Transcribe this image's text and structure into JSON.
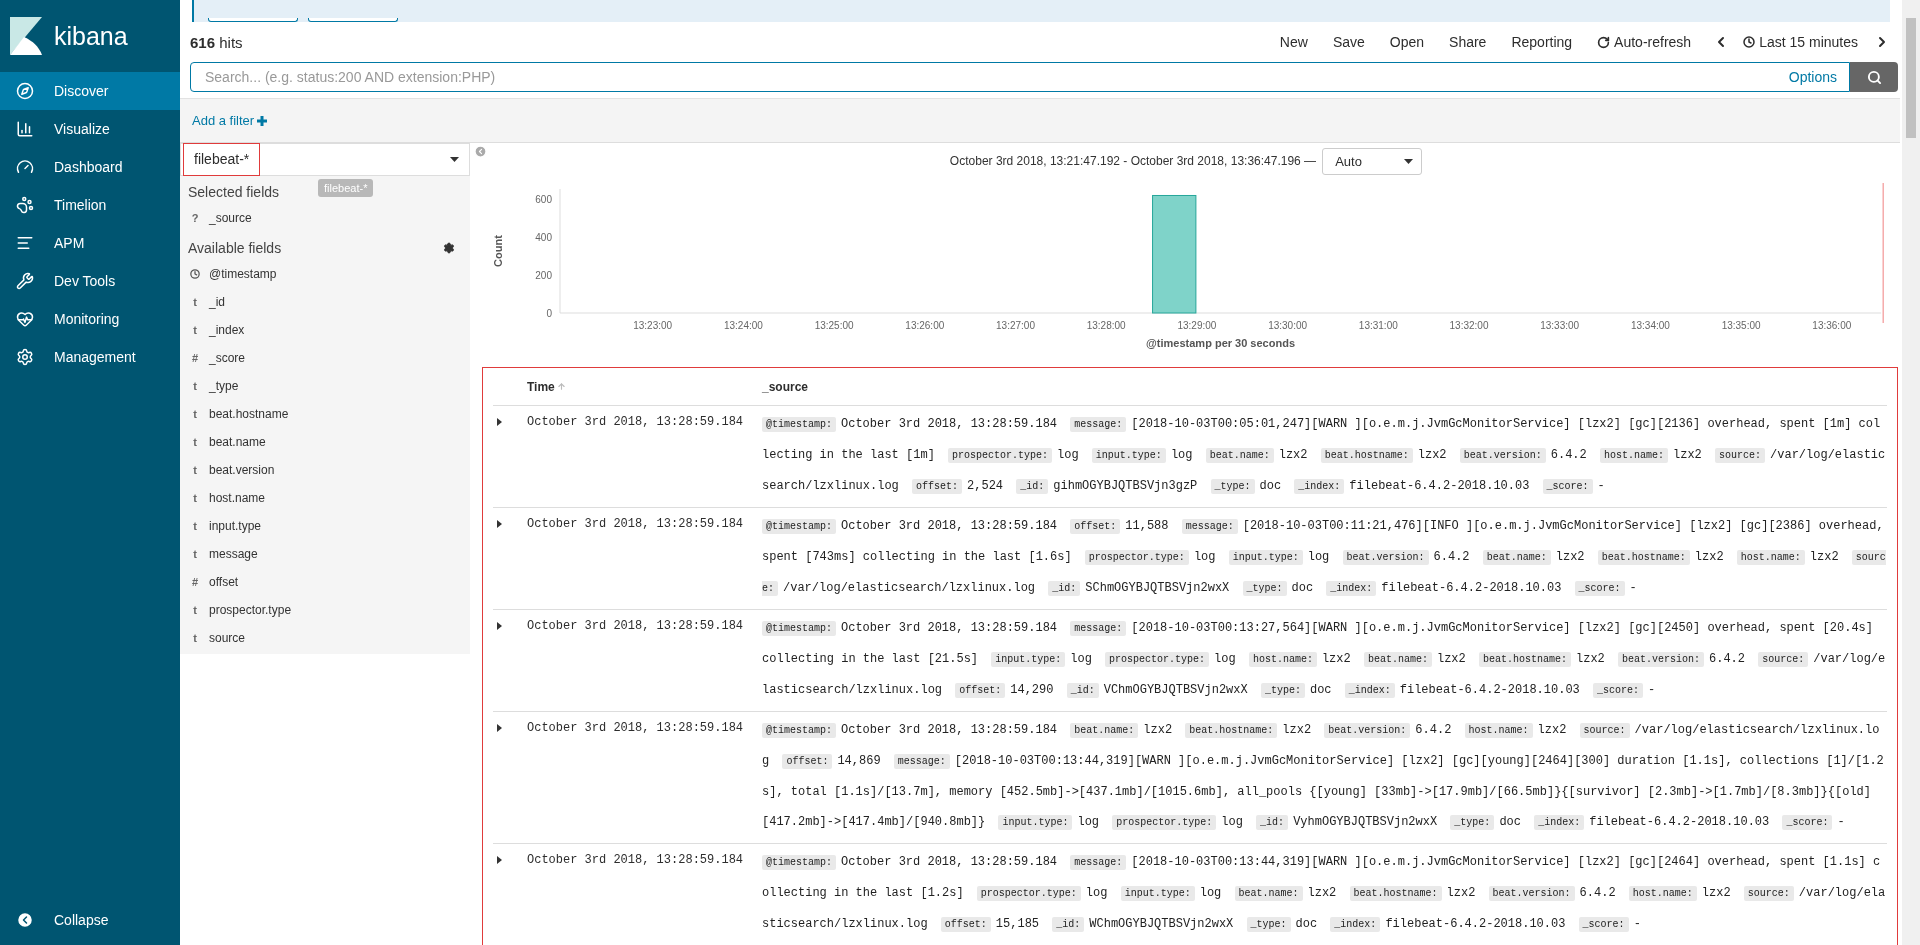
{
  "sidebar": {
    "logo": "kibana",
    "items": [
      {
        "label": "Discover",
        "selected": true
      },
      {
        "label": "Visualize",
        "selected": false
      },
      {
        "label": "Dashboard",
        "selected": false
      },
      {
        "label": "Timelion",
        "selected": false
      },
      {
        "label": "APM",
        "selected": false
      },
      {
        "label": "Dev Tools",
        "selected": false
      },
      {
        "label": "Monitoring",
        "selected": false
      },
      {
        "label": "Management",
        "selected": false
      }
    ],
    "collapse": "Collapse"
  },
  "hits": {
    "count": "616",
    "label": "hits"
  },
  "top_menu": [
    {
      "label": "New",
      "kind": "plain"
    },
    {
      "label": "Save",
      "kind": "plain"
    },
    {
      "label": "Open",
      "kind": "plain"
    },
    {
      "label": "Share",
      "kind": "plain"
    },
    {
      "label": "Reporting",
      "kind": "plain"
    },
    {
      "label": "Auto-refresh",
      "kind": "refresh"
    },
    {
      "label": "Last 15 minutes",
      "kind": "time"
    }
  ],
  "search": {
    "placeholder": "Search... (e.g. status:200 AND extension:PHP)",
    "options": "Options"
  },
  "filter": {
    "add": "Add a filter"
  },
  "index_pattern": {
    "value": "filebeat-*",
    "tooltip": "filebeat-*"
  },
  "selected_fields": {
    "title": "Selected fields",
    "items": [
      {
        "kind": "char",
        "icon": "?",
        "name": "_source"
      }
    ]
  },
  "available_fields": {
    "title": "Available fields",
    "items": [
      {
        "kind": "date",
        "name": "@timestamp"
      },
      {
        "kind": "char",
        "icon": "t",
        "name": "_id"
      },
      {
        "kind": "char",
        "icon": "t",
        "name": "_index"
      },
      {
        "kind": "char",
        "icon": "#",
        "name": "_score"
      },
      {
        "kind": "char",
        "icon": "t",
        "name": "_type"
      },
      {
        "kind": "char",
        "icon": "t",
        "name": "beat.hostname"
      },
      {
        "kind": "char",
        "icon": "t",
        "name": "beat.name"
      },
      {
        "kind": "char",
        "icon": "t",
        "name": "beat.version"
      },
      {
        "kind": "char",
        "icon": "t",
        "name": "host.name"
      },
      {
        "kind": "char",
        "icon": "t",
        "name": "input.type"
      },
      {
        "kind": "char",
        "icon": "t",
        "name": "message"
      },
      {
        "kind": "char",
        "icon": "#",
        "name": "offset"
      },
      {
        "kind": "char",
        "icon": "t",
        "name": "prospector.type"
      },
      {
        "kind": "char",
        "icon": "t",
        "name": "source"
      }
    ]
  },
  "chart": {
    "range": "October 3rd 2018, 13:21:47.192 - October 3rd 2018, 13:36:47.196 —",
    "interval": "Auto",
    "chart_data": {
      "type": "bar",
      "xlabel": "@timestamp per 30 seconds",
      "ylabel": "Count",
      "categories": [
        null,
        null,
        "13:23:00",
        null,
        "13:24:00",
        null,
        "13:25:00",
        null,
        "13:26:00",
        null,
        "13:27:00",
        null,
        "13:28:00",
        null,
        "13:29:00",
        null,
        "13:30:00",
        null,
        "13:31:00",
        null,
        "13:32:00",
        null,
        "13:33:00",
        null,
        "13:34:00",
        null,
        "13:35:00",
        null,
        "13:36:00"
      ],
      "series": [
        {
          "color": "#7fd3c9",
          "values": [
            null,
            null,
            null,
            null,
            null,
            null,
            null,
            null,
            null,
            null,
            null,
            null,
            null,
            616,
            null,
            null,
            null,
            null,
            null,
            null,
            null,
            null,
            null,
            null,
            null,
            null,
            null,
            null,
            null
          ]
        }
      ],
      "ylim": [
        0,
        650
      ],
      "yticks": [
        0,
        200,
        400,
        600
      ]
    }
  },
  "table": {
    "columns": [
      {
        "label": "Time",
        "sorted": true
      },
      {
        "label": "_source",
        "sorted": false
      }
    ],
    "rows": [
      {
        "time": "October 3rd 2018, 13:28:59.184",
        "fields": [
          {
            "key": "@timestamp:",
            "value": "October 3rd 2018, 13:28:59.184"
          },
          {
            "key": "message:",
            "value": "[2018-10-03T00:05:01,247][WARN ][o.e.m.j.JvmGcMonitorService] [lzx2] [gc][2136] overhead, spent [1m] collecting in the last [1m]"
          },
          {
            "key": "prospector.type:",
            "value": "log"
          },
          {
            "key": "input.type:",
            "value": "log"
          },
          {
            "key": "beat.name:",
            "value": "lzx2"
          },
          {
            "key": "beat.hostname:",
            "value": "lzx2"
          },
          {
            "key": "beat.version:",
            "value": "6.4.2"
          },
          {
            "key": "host.name:",
            "value": "lzx2"
          },
          {
            "key": "source:",
            "value": "/var/log/elasticsearch/lzxlinux.log"
          },
          {
            "key": "offset:",
            "value": "2,524"
          },
          {
            "key": "_id:",
            "value": "gihmOGYBJQTBSVjn3gzP"
          },
          {
            "key": "_type:",
            "value": "doc"
          },
          {
            "key": "_index:",
            "value": "filebeat-6.4.2-2018.10.03"
          },
          {
            "key": "_score:",
            "value": "-"
          }
        ]
      },
      {
        "time": "October 3rd 2018, 13:28:59.184",
        "fields": [
          {
            "key": "@timestamp:",
            "value": "October 3rd 2018, 13:28:59.184"
          },
          {
            "key": "offset:",
            "value": "11,588"
          },
          {
            "key": "message:",
            "value": "[2018-10-03T00:11:21,476][INFO ][o.e.m.j.JvmGcMonitorService] [lzx2] [gc][2386] overhead, spent [743ms] collecting in the last [1.6s]"
          },
          {
            "key": "prospector.type:",
            "value": "log"
          },
          {
            "key": "input.type:",
            "value": "log"
          },
          {
            "key": "beat.version:",
            "value": "6.4.2"
          },
          {
            "key": "beat.name:",
            "value": "lzx2"
          },
          {
            "key": "beat.hostname:",
            "value": "lzx2"
          },
          {
            "key": "host.name:",
            "value": "lzx2"
          },
          {
            "key": "source:",
            "value": "/var/log/elasticsearch/lzxlinux.log"
          },
          {
            "key": "_id:",
            "value": "SChmOGYBJQTBSVjn2wxX"
          },
          {
            "key": "_type:",
            "value": "doc"
          },
          {
            "key": "_index:",
            "value": "filebeat-6.4.2-2018.10.03"
          },
          {
            "key": "_score:",
            "value": "-"
          }
        ]
      },
      {
        "time": "October 3rd 2018, 13:28:59.184",
        "fields": [
          {
            "key": "@timestamp:",
            "value": "October 3rd 2018, 13:28:59.184"
          },
          {
            "key": "message:",
            "value": "[2018-10-03T00:13:27,564][WARN ][o.e.m.j.JvmGcMonitorService] [lzx2] [gc][2450] overhead, spent [20.4s] collecting in the last [21.5s]"
          },
          {
            "key": "input.type:",
            "value": "log"
          },
          {
            "key": "prospector.type:",
            "value": "log"
          },
          {
            "key": "host.name:",
            "value": "lzx2"
          },
          {
            "key": "beat.name:",
            "value": "lzx2"
          },
          {
            "key": "beat.hostname:",
            "value": "lzx2"
          },
          {
            "key": "beat.version:",
            "value": "6.4.2"
          },
          {
            "key": "source:",
            "value": "/var/log/elasticsearch/lzxlinux.log"
          },
          {
            "key": "offset:",
            "value": "14,290"
          },
          {
            "key": "_id:",
            "value": "VChmOGYBJQTBSVjn2wxX"
          },
          {
            "key": "_type:",
            "value": "doc"
          },
          {
            "key": "_index:",
            "value": "filebeat-6.4.2-2018.10.03"
          },
          {
            "key": "_score:",
            "value": "-"
          }
        ]
      },
      {
        "time": "October 3rd 2018, 13:28:59.184",
        "fields": [
          {
            "key": "@timestamp:",
            "value": "October 3rd 2018, 13:28:59.184"
          },
          {
            "key": "beat.name:",
            "value": "lzx2"
          },
          {
            "key": "beat.hostname:",
            "value": "lzx2"
          },
          {
            "key": "beat.version:",
            "value": "6.4.2"
          },
          {
            "key": "host.name:",
            "value": "lzx2"
          },
          {
            "key": "source:",
            "value": "/var/log/elasticsearch/lzxlinux.log"
          },
          {
            "key": "offset:",
            "value": "14,869"
          },
          {
            "key": "message:",
            "value": "[2018-10-03T00:13:44,319][WARN ][o.e.m.j.JvmGcMonitorService] [lzx2] [gc][young][2464][300] duration [1.1s], collections [1]/[1.2s], total [1.1s]/[13.7m], memory [452.5mb]->[437.1mb]/[1015.6mb], all_pools {[young] [33mb]->[17.9mb]/[66.5mb]}{[survivor] [2.3mb]->[1.7mb]/[8.3mb]}{[old] [417.2mb]->[417.4mb]/[940.8mb]}"
          },
          {
            "key": "input.type:",
            "value": "log"
          },
          {
            "key": "prospector.type:",
            "value": "log"
          },
          {
            "key": "_id:",
            "value": "VyhmOGYBJQTBSVjn2wxX"
          },
          {
            "key": "_type:",
            "value": "doc"
          },
          {
            "key": "_index:",
            "value": "filebeat-6.4.2-2018.10.03"
          },
          {
            "key": "_score:",
            "value": "-"
          }
        ]
      },
      {
        "time": "October 3rd 2018, 13:28:59.184",
        "fields": [
          {
            "key": "@timestamp:",
            "value": "October 3rd 2018, 13:28:59.184"
          },
          {
            "key": "message:",
            "value": "[2018-10-03T00:13:44,319][WARN ][o.e.m.j.JvmGcMonitorService] [lzx2] [gc][2464] overhead, spent [1.1s] collecting in the last [1.2s]"
          },
          {
            "key": "prospector.type:",
            "value": "log"
          },
          {
            "key": "input.type:",
            "value": "log"
          },
          {
            "key": "beat.name:",
            "value": "lzx2"
          },
          {
            "key": "beat.hostname:",
            "value": "lzx2"
          },
          {
            "key": "beat.version:",
            "value": "6.4.2"
          },
          {
            "key": "host.name:",
            "value": "lzx2"
          },
          {
            "key": "source:",
            "value": "/var/log/elasticsearch/lzxlinux.log"
          },
          {
            "key": "offset:",
            "value": "15,185"
          },
          {
            "key": "_id:",
            "value": "WChmOGYBJQTBSVjn2wxX"
          },
          {
            "key": "_type:",
            "value": "doc"
          },
          {
            "key": "_index:",
            "value": "filebeat-6.4.2-2018.10.03"
          },
          {
            "key": "_score:",
            "value": "-"
          }
        ]
      }
    ]
  }
}
